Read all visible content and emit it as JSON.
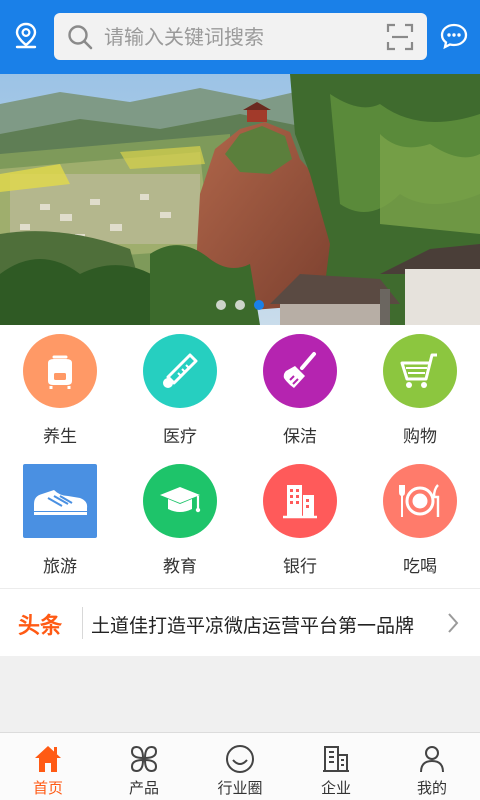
{
  "header": {
    "location_icon": "location-pin-icon",
    "search": {
      "placeholder": "请输入关键词搜索",
      "value": "",
      "icon": "search-icon",
      "scan_icon": "scan-icon"
    },
    "message_icon": "chat-bubble-icon"
  },
  "banner": {
    "image": "scenic mountain village photo",
    "slide_count": 3,
    "active_slide": 3
  },
  "categories": [
    {
      "label": "养生",
      "icon": "rice-cooker-icon",
      "color": "#ff9966"
    },
    {
      "label": "医疗",
      "icon": "thermometer-icon",
      "color": "#26cfc0"
    },
    {
      "label": "保洁",
      "icon": "broom-icon",
      "color": "#b524b0"
    },
    {
      "label": "购物",
      "icon": "shopping-cart-icon",
      "color": "#8cc63f"
    },
    {
      "label": "旅游",
      "icon": "sneaker-icon",
      "color": "#4a90e2"
    },
    {
      "label": "教育",
      "icon": "graduation-cap-icon",
      "color": "#1ec46a"
    },
    {
      "label": "银行",
      "icon": "building-icon",
      "color": "#ff5a5a"
    },
    {
      "label": "吃喝",
      "icon": "plate-cutlery-icon",
      "color": "#ff7b6b"
    }
  ],
  "headline": {
    "badge": "头条",
    "text": "土道佳打造平凉微店运营平台第一品牌",
    "arrow_icon": "chevron-right-icon"
  },
  "tabbar": {
    "items": [
      {
        "label": "首页",
        "icon": "home-icon",
        "active": true
      },
      {
        "label": "产品",
        "icon": "grid-petals-icon",
        "active": false
      },
      {
        "label": "行业圈",
        "icon": "smile-circle-icon",
        "active": false
      },
      {
        "label": "企业",
        "icon": "office-building-icon",
        "active": false
      },
      {
        "label": "我的",
        "icon": "person-icon",
        "active": false
      }
    ]
  },
  "colors": {
    "primary": "#1a80e8",
    "accent": "#ff5a14"
  }
}
